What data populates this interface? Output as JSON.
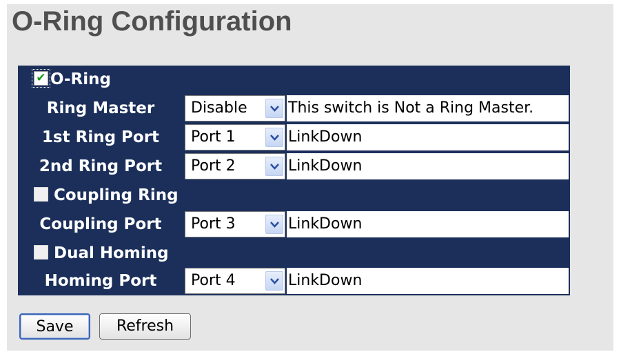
{
  "page": {
    "title": "O-Ring Configuration"
  },
  "oring": {
    "checkbox_label": "O-Ring",
    "checked": true,
    "fields": [
      {
        "label": "Ring Master",
        "select_value": "Disable",
        "status": "This switch is Not a Ring Master."
      },
      {
        "label": "1st Ring Port",
        "select_value": "Port 1",
        "status": "LinkDown"
      },
      {
        "label": "2nd Ring Port",
        "select_value": "Port 2",
        "status": "LinkDown"
      }
    ]
  },
  "coupling": {
    "checkbox_label": "Coupling Ring",
    "checked": false,
    "fields": [
      {
        "label": "Coupling Port",
        "select_value": "Port 3",
        "status": "LinkDown"
      }
    ]
  },
  "dual_homing": {
    "checkbox_label": "Dual Homing",
    "checked": false,
    "fields": [
      {
        "label": "Homing Port",
        "select_value": "Port 4",
        "status": "LinkDown"
      }
    ]
  },
  "buttons": {
    "save_label": "Save",
    "refresh_label": "Refresh"
  },
  "icons": {
    "checkmark": "check-icon",
    "dropdown": "chevron-down-icon"
  },
  "colors": {
    "header_bg": "#1b2f5a",
    "panel_bg": "#e6e6e6",
    "title": "#4f4f4f",
    "check": "#1a9a1a"
  }
}
